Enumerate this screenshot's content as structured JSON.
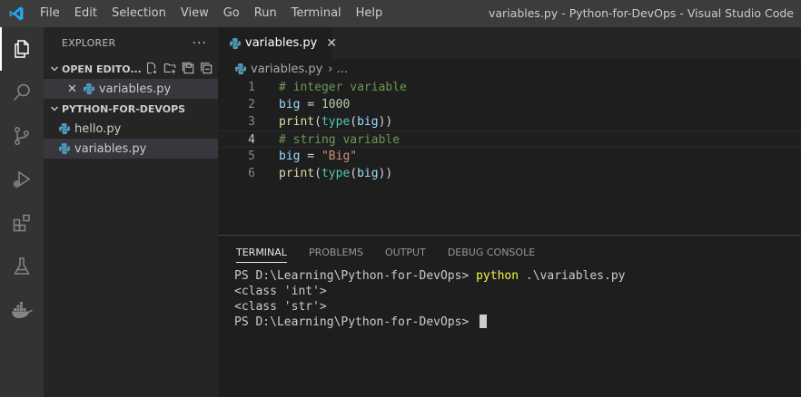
{
  "titlebar": {
    "menu": [
      "File",
      "Edit",
      "Selection",
      "View",
      "Go",
      "Run",
      "Terminal",
      "Help"
    ],
    "title": "variables.py - Python-for-DevOps - Visual Studio Code"
  },
  "activitybar": {
    "items": [
      "explorer-icon",
      "search-icon",
      "source-control-icon",
      "run-debug-icon",
      "extensions-icon",
      "testing-icon",
      "docker-icon"
    ]
  },
  "sidebar": {
    "header": "EXPLORER",
    "more": "···",
    "open_editors_label": "OPEN EDITO...",
    "open_editors": [
      {
        "name": "variables.py",
        "close": "✕"
      }
    ],
    "folder_label": "PYTHON-FOR-DEVOPS",
    "files": [
      "hello.py",
      "variables.py"
    ]
  },
  "tabs": [
    {
      "label": "variables.py",
      "close": "✕"
    }
  ],
  "breadcrumb": {
    "file": "variables.py",
    "ellipsis": "›  ..."
  },
  "editor": {
    "lines": [
      {
        "num": "1",
        "tokens": [
          {
            "t": "# integer variable",
            "c": "comment"
          }
        ]
      },
      {
        "num": "2",
        "tokens": [
          {
            "t": "big",
            "c": "var"
          },
          {
            "t": " = ",
            "c": "op"
          },
          {
            "t": "1000",
            "c": "num"
          }
        ]
      },
      {
        "num": "3",
        "tokens": [
          {
            "t": "print",
            "c": "fn"
          },
          {
            "t": "(",
            "c": "op"
          },
          {
            "t": "type",
            "c": "type"
          },
          {
            "t": "(",
            "c": "op"
          },
          {
            "t": "big",
            "c": "var"
          },
          {
            "t": "))",
            "c": "op"
          }
        ]
      },
      {
        "num": "4",
        "tokens": [
          {
            "t": "# string variable",
            "c": "comment"
          }
        ]
      },
      {
        "num": "5",
        "tokens": [
          {
            "t": "big",
            "c": "var"
          },
          {
            "t": " = ",
            "c": "op"
          },
          {
            "t": "\"Big\"",
            "c": "str"
          }
        ]
      },
      {
        "num": "6",
        "tokens": [
          {
            "t": "print",
            "c": "fn"
          },
          {
            "t": "(",
            "c": "op"
          },
          {
            "t": "type",
            "c": "type"
          },
          {
            "t": "(",
            "c": "op"
          },
          {
            "t": "big",
            "c": "var"
          },
          {
            "t": "))",
            "c": "op"
          }
        ]
      }
    ]
  },
  "panel": {
    "tabs": [
      "TERMINAL",
      "PROBLEMS",
      "OUTPUT",
      "DEBUG CONSOLE"
    ],
    "terminal": {
      "prompt1": "PS D:\\Learning\\Python-for-DevOps> ",
      "cmd": "python",
      "args": " .\\variables.py",
      "out1": "<class 'int'>",
      "out2": "<class 'str'>",
      "prompt2": "PS D:\\Learning\\Python-for-DevOps> "
    }
  }
}
